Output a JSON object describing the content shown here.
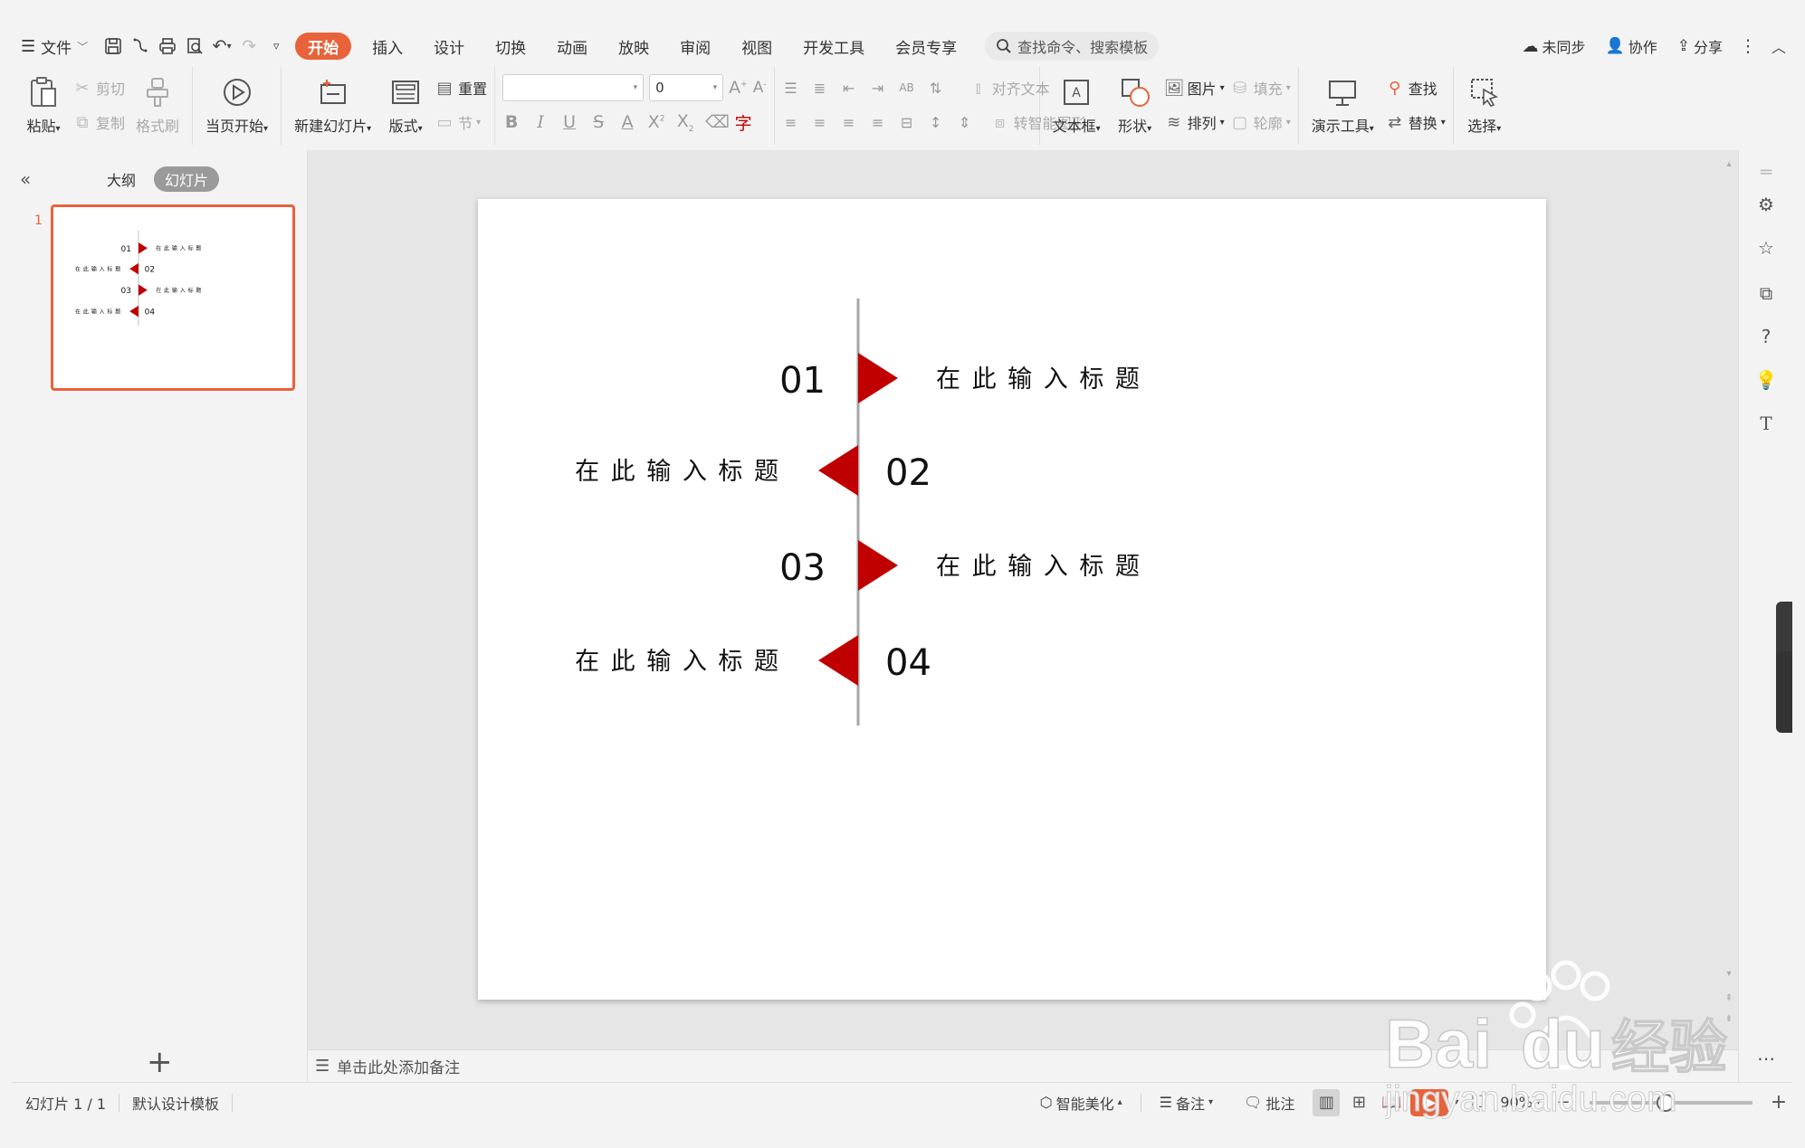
{
  "menubar": {
    "file": "文件",
    "tabs": [
      "开始",
      "插入",
      "设计",
      "切换",
      "动画",
      "放映",
      "审阅",
      "视图",
      "开发工具",
      "会员专享"
    ],
    "active_tab_index": 0,
    "search_placeholder": "查找命令、搜索模板",
    "unsynced": "未同步",
    "collaborate": "协作",
    "share": "分享"
  },
  "ribbon": {
    "paste": "粘贴",
    "cut": "剪切",
    "copy": "复制",
    "format_painter": "格式刷",
    "play_from_current": "当页开始",
    "new_slide": "新建幻灯片",
    "layout": "版式",
    "reset": "重置",
    "section": "节",
    "font_name": "",
    "font_size": "0",
    "align_text": "对齐文本",
    "smartart": "转智能图形",
    "textbox": "文本框",
    "shape": "形状",
    "picture": "图片",
    "arrange": "排列",
    "fill": "填充",
    "outline": "轮廓",
    "presentation_tools": "演示工具",
    "find": "查找",
    "replace": "替换",
    "select": "选择"
  },
  "leftpanel": {
    "outline_tab": "大纲",
    "slides_tab": "幻灯片",
    "slide_number": "1"
  },
  "slide": {
    "items": [
      {
        "num": "01",
        "title": "在 此 输 入 标 题",
        "side": "right"
      },
      {
        "num": "02",
        "title": "在 此 输 入 标 题",
        "side": "left"
      },
      {
        "num": "03",
        "title": "在 此 输 入 标 题",
        "side": "right"
      },
      {
        "num": "04",
        "title": "在 此 输 入 标 题",
        "side": "left"
      }
    ],
    "accent_color": "#c00000"
  },
  "notes": {
    "placeholder": "单击此处添加备注"
  },
  "statusbar": {
    "slide_info": "幻灯片 1 / 1",
    "template": "默认设计模板",
    "beautify": "智能美化",
    "notes": "备注",
    "comments": "批注",
    "zoom": "90%"
  },
  "watermark": {
    "brand": "Bai",
    "brand2": "经验",
    "url": "jingyan.baidu.com"
  }
}
